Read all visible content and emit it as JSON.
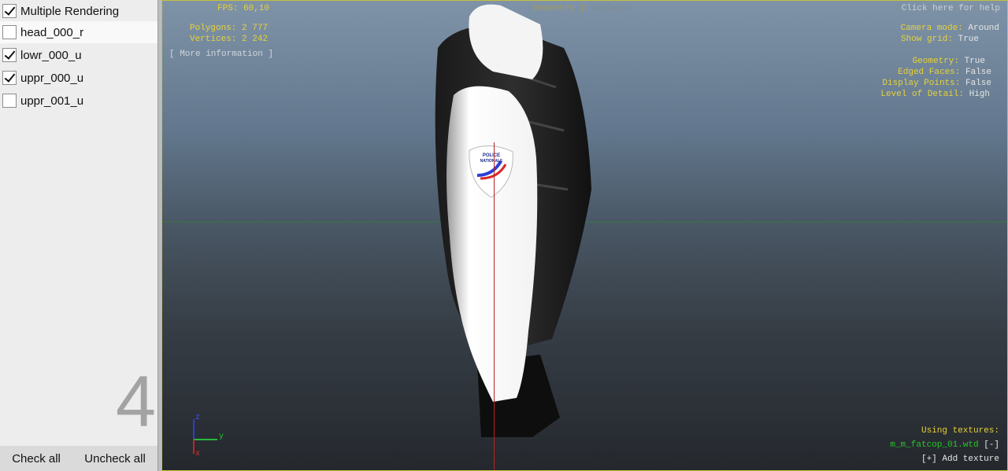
{
  "layers": {
    "master": {
      "label": "Multiple Rendering",
      "checked": true
    },
    "items": [
      {
        "label": "head_000_r",
        "checked": false,
        "selected": true
      },
      {
        "label": "lowr_000_u",
        "checked": true,
        "selected": false
      },
      {
        "label": "uppr_000_u",
        "checked": true,
        "selected": false
      },
      {
        "label": "uppr_001_u",
        "checked": false,
        "selected": false
      }
    ],
    "count": "4"
  },
  "buttons": {
    "check_all": "Check all",
    "uncheck_all": "Uncheck all"
  },
  "overlay": {
    "fps": "FPS: 60,10",
    "polygons": "Polygons: 2 777",
    "vertices": "Vertices: 2 242",
    "more_info": "[ More information ]",
    "tab_geometry": "Geometry",
    "tab_sep": "|",
    "tab_skeleton": "Skeleton",
    "help": "Click here for help",
    "camera_mode_label": "Camera mode:",
    "camera_mode_value": "Around",
    "show_grid_label": "Show grid:",
    "show_grid_value": "True",
    "geometry_label": "Geometry:",
    "geometry_value": "True",
    "edged_label": "Edged Faces:",
    "edged_value": "False",
    "points_label": "Display Points:",
    "points_value": "False",
    "lod_label": "Level of Detail:",
    "lod_value": "High",
    "using_textures": "Using textures:",
    "texture_file": "m_m_fatcop_01.wtd",
    "texture_remove": "[-]",
    "add_texture": "[+] Add texture"
  },
  "axes": {
    "z": "z",
    "y": "y",
    "x": "x"
  },
  "model": {
    "patch_line1": "POLICE",
    "patch_line2": "NATIONALE"
  },
  "colors": {
    "hud_yellow": "#e6d23a",
    "texture_green": "#28c428",
    "axis_red": "#b82222",
    "axis_blue": "#2b3fd8"
  }
}
